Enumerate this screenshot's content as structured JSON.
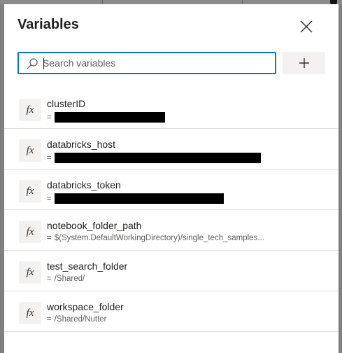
{
  "panel": {
    "title": "Variables",
    "close_icon": "close-icon",
    "search": {
      "placeholder": "Search variables",
      "value": "",
      "icon": "search-icon"
    },
    "add_icon": "plus-icon"
  },
  "variables": [
    {
      "name": "clusterID",
      "prefix": "=",
      "value": "",
      "redacted": true,
      "icon_label": "fx"
    },
    {
      "name": "databricks_host",
      "prefix": "=",
      "value": "",
      "redacted": true,
      "icon_label": "fx"
    },
    {
      "name": "databricks_token",
      "prefix": "=",
      "value": "",
      "redacted": true,
      "icon_label": "fx"
    },
    {
      "name": "notebook_folder_path",
      "prefix": "=",
      "value": "$(System.DefaultWorkingDirectory)/single_tech_samples...",
      "redacted": false,
      "icon_label": "fx"
    },
    {
      "name": "test_search_folder",
      "prefix": "=",
      "value": "/Shared/",
      "redacted": false,
      "icon_label": "fx"
    },
    {
      "name": "workspace_folder",
      "prefix": "=",
      "value": "/Shared/Nutter",
      "redacted": false,
      "icon_label": "fx"
    }
  ],
  "colors": {
    "accent": "#0078d4",
    "badge_bg": "#f3f2f1",
    "divider": "#e1dfdd",
    "backdrop": "#7f7f7f"
  }
}
